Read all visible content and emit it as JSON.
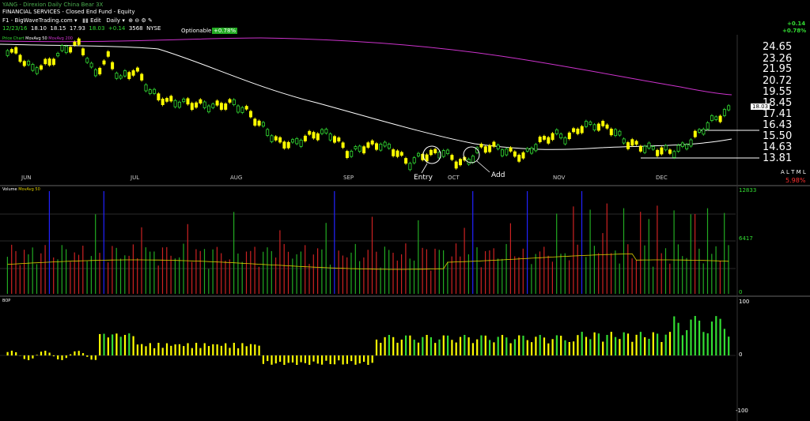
{
  "header": {
    "title": "YANG - Direxion Daily China Bear 3X",
    "sector": "FINANCIAL SERVICES - Closed End Fund - Equity",
    "site": "F1 - BigWaveTrading.com",
    "edit_label": "Edit",
    "interval": "Daily",
    "date": "12/23/16",
    "open": "18.10",
    "high": "18.15",
    "low": "17.93",
    "close": "18.03",
    "change": "+0.14",
    "volume": "3568",
    "exchange": "NYSE",
    "optionable_label": "Optionable",
    "pct_change": "+0.78%",
    "right_change": "+0.14",
    "right_pct": "+0.78%"
  },
  "price_panel": {
    "legend_a": "Price Chart",
    "legend_b": "MovAvg 50",
    "legend_c": "MovAvg 200",
    "y_labels": [
      "24.65",
      "23.26",
      "21.95",
      "20.72",
      "19.55",
      "18.45",
      "17.41",
      "16.43",
      "15.50",
      "14.63",
      "13.81"
    ],
    "current_price": "18.03",
    "months": [
      "JUN",
      "JUL",
      "AUG",
      "SEP",
      "OCT",
      "NOV",
      "DEC"
    ],
    "entry_label": "Entry",
    "add_label": "Add",
    "altm": "A L T M L",
    "pct_right": "5.98%"
  },
  "volume_panel": {
    "legend": "Volume",
    "legend_b": "MovAvg 50",
    "y_top": "12833",
    "y_mid": "6417",
    "y_bot": "0"
  },
  "bop_panel": {
    "legend": "BOP",
    "y_top": "100",
    "y_mid": "0",
    "y_bot": "-100"
  },
  "colors": {
    "up": "#33dd33",
    "down": "#ffff00",
    "ma50": "#ffffff",
    "ma200": "#cc33cc",
    "vol_down": "#cc2222",
    "vol_up": "#22aa22",
    "vol_spike": "#2222ff",
    "vol_ma": "#ddcc00"
  }
}
